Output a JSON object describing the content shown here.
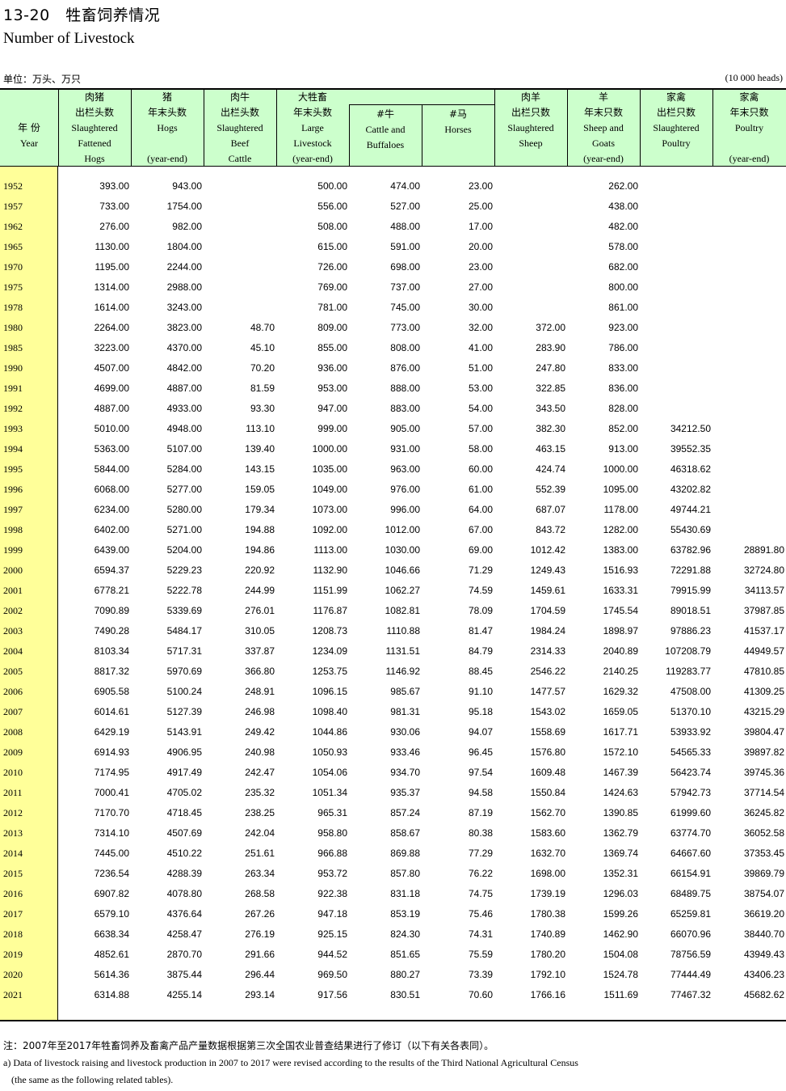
{
  "title_cn": "13-20　牲畜饲养情况",
  "title_en": "Number of Livestock",
  "unit_cn": "单位：万头、万只",
  "unit_en": "(10 000 heads)",
  "columns": [
    {
      "cn": "年 份",
      "en": "Year"
    },
    {
      "cn": "肉猪|出栏头数",
      "en": "Slaughtered|Fattened|Hogs"
    },
    {
      "cn": "猪|年末头数",
      "en": "Hogs||(year-end)"
    },
    {
      "cn": "肉牛|出栏头数",
      "en": "Slaughtered|Beef|Cattle"
    },
    {
      "cn": "大牲畜|年末头数",
      "en": "Large|Livestock|(year-end)"
    },
    {
      "cn": "#牛",
      "en": "Cattle and|Buffaloes"
    },
    {
      "cn": "#马",
      "en": "Horses"
    },
    {
      "cn": "肉羊|出栏只数",
      "en": "Slaughtered|Sheep"
    },
    {
      "cn": "羊|年末只数",
      "en": "Sheep and|Goats|(year-end)"
    },
    {
      "cn": "家禽|出栏只数",
      "en": "Slaughtered|Poultry"
    },
    {
      "cn": "家禽|年末只数",
      "en": "Poultry||(year-end)"
    }
  ],
  "rows": [
    [
      "1952",
      "393.00",
      "943.00",
      "",
      "500.00",
      "474.00",
      "23.00",
      "",
      "262.00",
      "",
      ""
    ],
    [
      "1957",
      "733.00",
      "1754.00",
      "",
      "556.00",
      "527.00",
      "25.00",
      "",
      "438.00",
      "",
      ""
    ],
    [
      "1962",
      "276.00",
      "982.00",
      "",
      "508.00",
      "488.00",
      "17.00",
      "",
      "482.00",
      "",
      ""
    ],
    [
      "1965",
      "1130.00",
      "1804.00",
      "",
      "615.00",
      "591.00",
      "20.00",
      "",
      "578.00",
      "",
      ""
    ],
    [
      "1970",
      "1195.00",
      "2244.00",
      "",
      "726.00",
      "698.00",
      "23.00",
      "",
      "682.00",
      "",
      ""
    ],
    [
      "1975",
      "1314.00",
      "2988.00",
      "",
      "769.00",
      "737.00",
      "27.00",
      "",
      "800.00",
      "",
      ""
    ],
    [
      "1978",
      "1614.00",
      "3243.00",
      "",
      "781.00",
      "745.00",
      "30.00",
      "",
      "861.00",
      "",
      ""
    ],
    [
      "1980",
      "2264.00",
      "3823.00",
      "48.70",
      "809.00",
      "773.00",
      "32.00",
      "372.00",
      "923.00",
      "",
      ""
    ],
    [
      "1985",
      "3223.00",
      "4370.00",
      "45.10",
      "855.00",
      "808.00",
      "41.00",
      "283.90",
      "786.00",
      "",
      ""
    ],
    [
      "1990",
      "4507.00",
      "4842.00",
      "70.20",
      "936.00",
      "876.00",
      "51.00",
      "247.80",
      "833.00",
      "",
      ""
    ],
    [
      "1991",
      "4699.00",
      "4887.00",
      "81.59",
      "953.00",
      "888.00",
      "53.00",
      "322.85",
      "836.00",
      "",
      ""
    ],
    [
      "1992",
      "4887.00",
      "4933.00",
      "93.30",
      "947.00",
      "883.00",
      "54.00",
      "343.50",
      "828.00",
      "",
      ""
    ],
    [
      "1993",
      "5010.00",
      "4948.00",
      "113.10",
      "999.00",
      "905.00",
      "57.00",
      "382.30",
      "852.00",
      "34212.50",
      ""
    ],
    [
      "1994",
      "5363.00",
      "5107.00",
      "139.40",
      "1000.00",
      "931.00",
      "58.00",
      "463.15",
      "913.00",
      "39552.35",
      ""
    ],
    [
      "1995",
      "5844.00",
      "5284.00",
      "143.15",
      "1035.00",
      "963.00",
      "60.00",
      "424.74",
      "1000.00",
      "46318.62",
      ""
    ],
    [
      "1996",
      "6068.00",
      "5277.00",
      "159.05",
      "1049.00",
      "976.00",
      "61.00",
      "552.39",
      "1095.00",
      "43202.82",
      ""
    ],
    [
      "1997",
      "6234.00",
      "5280.00",
      "179.34",
      "1073.00",
      "996.00",
      "64.00",
      "687.07",
      "1178.00",
      "49744.21",
      ""
    ],
    [
      "1998",
      "6402.00",
      "5271.00",
      "194.88",
      "1092.00",
      "1012.00",
      "67.00",
      "843.72",
      "1282.00",
      "55430.69",
      ""
    ],
    [
      "1999",
      "6439.00",
      "5204.00",
      "194.86",
      "1113.00",
      "1030.00",
      "69.00",
      "1012.42",
      "1383.00",
      "63782.96",
      "28891.80"
    ],
    [
      "2000",
      "6594.37",
      "5229.23",
      "220.92",
      "1132.90",
      "1046.66",
      "71.29",
      "1249.43",
      "1516.93",
      "72291.88",
      "32724.80"
    ],
    [
      "2001",
      "6778.21",
      "5222.78",
      "244.99",
      "1151.99",
      "1062.27",
      "74.59",
      "1459.61",
      "1633.31",
      "79915.99",
      "34113.57"
    ],
    [
      "2002",
      "7090.89",
      "5339.69",
      "276.01",
      "1176.87",
      "1082.81",
      "78.09",
      "1704.59",
      "1745.54",
      "89018.51",
      "37987.85"
    ],
    [
      "2003",
      "7490.28",
      "5484.17",
      "310.05",
      "1208.73",
      "1110.88",
      "81.47",
      "1984.24",
      "1898.97",
      "97886.23",
      "41537.17"
    ],
    [
      "2004",
      "8103.34",
      "5717.31",
      "337.87",
      "1234.09",
      "1131.51",
      "84.79",
      "2314.33",
      "2040.89",
      "107208.79",
      "44949.57"
    ],
    [
      "2005",
      "8817.32",
      "5970.69",
      "366.80",
      "1253.75",
      "1146.92",
      "88.45",
      "2546.22",
      "2140.25",
      "119283.77",
      "47810.85"
    ],
    [
      "2006",
      "6905.58",
      "5100.24",
      "248.91",
      "1096.15",
      "985.67",
      "91.10",
      "1477.57",
      "1629.32",
      "47508.00",
      "41309.25"
    ],
    [
      "2007",
      "6014.61",
      "5127.39",
      "246.98",
      "1098.40",
      "981.31",
      "95.18",
      "1543.02",
      "1659.05",
      "51370.10",
      "43215.29"
    ],
    [
      "2008",
      "6429.19",
      "5143.91",
      "249.42",
      "1044.86",
      "930.06",
      "94.07",
      "1558.69",
      "1617.71",
      "53933.92",
      "39804.47"
    ],
    [
      "2009",
      "6914.93",
      "4906.95",
      "240.98",
      "1050.93",
      "933.46",
      "96.45",
      "1576.80",
      "1572.10",
      "54565.33",
      "39897.82"
    ],
    [
      "2010",
      "7174.95",
      "4917.49",
      "242.47",
      "1054.06",
      "934.70",
      "97.54",
      "1609.48",
      "1467.39",
      "56423.74",
      "39745.36"
    ],
    [
      "2011",
      "7000.41",
      "4705.02",
      "235.32",
      "1051.34",
      "935.37",
      "94.58",
      "1550.84",
      "1424.63",
      "57942.73",
      "37714.54"
    ],
    [
      "2012",
      "7170.70",
      "4718.45",
      "238.25",
      "965.31",
      "857.24",
      "87.19",
      "1562.70",
      "1390.85",
      "61999.60",
      "36245.82"
    ],
    [
      "2013",
      "7314.10",
      "4507.69",
      "242.04",
      "958.80",
      "858.67",
      "80.38",
      "1583.60",
      "1362.79",
      "63774.70",
      "36052.58"
    ],
    [
      "2014",
      "7445.00",
      "4510.22",
      "251.61",
      "966.88",
      "869.88",
      "77.29",
      "1632.70",
      "1369.74",
      "64667.60",
      "37353.45"
    ],
    [
      "2015",
      "7236.54",
      "4288.39",
      "263.34",
      "953.72",
      "857.80",
      "76.22",
      "1698.00",
      "1352.31",
      "66154.91",
      "39869.79"
    ],
    [
      "2016",
      "6907.82",
      "4078.80",
      "268.58",
      "922.38",
      "831.18",
      "74.75",
      "1739.19",
      "1296.03",
      "68489.75",
      "38754.07"
    ],
    [
      "2017",
      "6579.10",
      "4376.64",
      "267.26",
      "947.18",
      "853.19",
      "75.46",
      "1780.38",
      "1599.26",
      "65259.81",
      "36619.20"
    ],
    [
      "2018",
      "6638.34",
      "4258.47",
      "276.19",
      "925.15",
      "824.30",
      "74.31",
      "1740.89",
      "1462.90",
      "66070.96",
      "38440.70"
    ],
    [
      "2019",
      "4852.61",
      "2870.70",
      "291.66",
      "944.52",
      "851.65",
      "75.59",
      "1780.20",
      "1504.08",
      "78756.59",
      "43949.43"
    ],
    [
      "2020",
      "5614.36",
      "3875.44",
      "296.44",
      "969.50",
      "880.27",
      "73.39",
      "1792.10",
      "1524.78",
      "77444.49",
      "43406.23"
    ],
    [
      "2021",
      "6314.88",
      "4255.14",
      "293.14",
      "917.56",
      "830.51",
      "70.60",
      "1766.16",
      "1511.69",
      "77467.32",
      "45682.62"
    ]
  ],
  "note_cn": "注：2007年至2017年牲畜饲养及畜禽产品产量数据根据第三次全国农业普查结果进行了修订（以下有关各表同）。",
  "note_en_1": "a) Data of livestock raising and livestock production in 2007 to 2017 were revised according to the results of the Third National Agricultural Census",
  "note_en_2": "(the same as the following related tables).",
  "colors": {
    "header_bg": "#ccffcc",
    "year_bg": "#ffff99"
  }
}
